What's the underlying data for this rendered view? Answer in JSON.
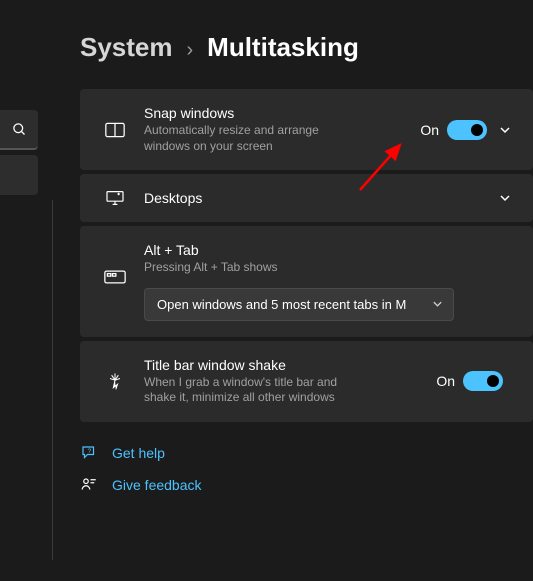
{
  "breadcrumb": {
    "parent": "System",
    "sep": "›",
    "current": "Multitasking"
  },
  "snap": {
    "title": "Snap windows",
    "sub": "Automatically resize and arrange windows on your screen",
    "status": "On"
  },
  "desktops": {
    "title": "Desktops"
  },
  "alttab": {
    "title": "Alt + Tab",
    "sub": "Pressing Alt + Tab shows",
    "dropdown": "Open windows and 5 most recent tabs in M"
  },
  "shake": {
    "title": "Title bar window shake",
    "sub": "When I grab a window's title bar and shake it, minimize all other windows",
    "status": "On"
  },
  "links": {
    "help": "Get help",
    "feedback": "Give feedback"
  }
}
